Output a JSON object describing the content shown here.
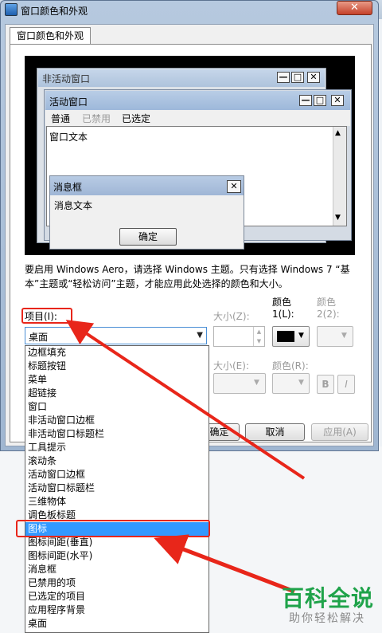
{
  "window": {
    "title": "窗口颜色和外观",
    "minimize_glyph": "—",
    "maximize_glyph": "□",
    "close_glyph": "✕"
  },
  "tab": {
    "label": "窗口颜色和外观"
  },
  "preview": {
    "inactive_title": "非活动窗口",
    "active_title": "活动窗口",
    "menu": [
      "普通",
      "已禁用",
      "已选定"
    ],
    "window_text": "窗口文本",
    "msgbox_title": "消息框",
    "msgbox_text": "消息文本",
    "ok_label": "确定"
  },
  "info_text": {
    "line1": "要启用 Windows Aero，请选择 Windows 主题。只有选择 Windows 7 “基",
    "line2": "本”主题或“轻松访问”主题，才能应用此处选择的颜色和大小。"
  },
  "item": {
    "label": "项目(I):",
    "selected_value": "桌面"
  },
  "size_label": "大小(Z):",
  "color1_label": {
    "line1": "颜色",
    "line2": "1(L):"
  },
  "color2_label": {
    "line1": "颜色",
    "line2": "2(2):"
  },
  "font_size_label": "大小(E):",
  "font_color_label": "颜色(R):",
  "bold_label": "B",
  "italic_label": "I",
  "buttons": {
    "ok": "确定",
    "cancel": "取消",
    "apply": "应用(A)"
  },
  "dropdown_items": [
    "边框填充",
    "标题按钮",
    "菜单",
    "超链接",
    "窗口",
    "非活动窗口边框",
    "非活动窗口标题栏",
    "工具提示",
    "滚动条",
    "活动窗口边框",
    "活动窗口标题栏",
    "三维物体",
    "调色板标题",
    "图标",
    "图标间距(垂直)",
    "图标间距(水平)",
    "消息框",
    "已禁用的项",
    "已选定的项目",
    "应用程序背景",
    "桌面"
  ],
  "selected_dropdown_index": 13,
  "watermark": {
    "big": "百科全说",
    "small": "助你轻松解决"
  },
  "colors": {
    "accent_red": "#e8261a",
    "selection_blue": "#3399ff",
    "watermark_green": "#1fa34a"
  }
}
